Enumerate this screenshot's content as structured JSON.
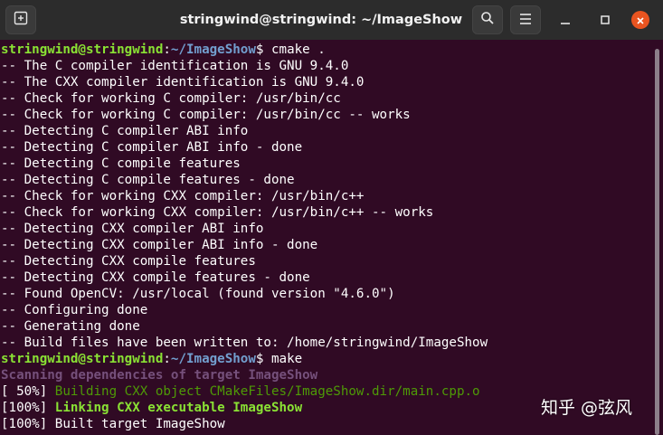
{
  "window": {
    "title": "stringwind@stringwind: ~/ImageShow"
  },
  "colors": {
    "background": "#300a24",
    "titlebar": "#2c2c2c",
    "prompt_user": "#8ae234",
    "prompt_path": "#729fcf",
    "scanning": "#75507b",
    "building": "#4e9a06",
    "close_button": "#e95420"
  },
  "icons": {
    "new_tab": "new-tab-icon",
    "search": "search-icon",
    "menu": "hamburger-menu-icon",
    "minimize": "minimize-icon",
    "maximize": "maximize-icon",
    "close": "close-icon"
  },
  "terminal": {
    "prompt1": {
      "user": "stringwind@stringwind",
      "sep": ":",
      "path": "~/ImageShow",
      "sym": "$ ",
      "cmd": "cmake ."
    },
    "cmake_output": [
      "-- The C compiler identification is GNU 9.4.0",
      "-- The CXX compiler identification is GNU 9.4.0",
      "-- Check for working C compiler: /usr/bin/cc",
      "-- Check for working C compiler: /usr/bin/cc -- works",
      "-- Detecting C compiler ABI info",
      "-- Detecting C compiler ABI info - done",
      "-- Detecting C compile features",
      "-- Detecting C compile features - done",
      "-- Check for working CXX compiler: /usr/bin/c++",
      "-- Check for working CXX compiler: /usr/bin/c++ -- works",
      "-- Detecting CXX compiler ABI info",
      "-- Detecting CXX compiler ABI info - done",
      "-- Detecting CXX compile features",
      "-- Detecting CXX compile features - done",
      "-- Found OpenCV: /usr/local (found version \"4.6.0\")",
      "-- Configuring done",
      "-- Generating done",
      "-- Build files have been written to: /home/stringwind/ImageShow"
    ],
    "prompt2": {
      "user": "stringwind@stringwind",
      "sep": ":",
      "path": "~/ImageShow",
      "sym": "$ ",
      "cmd": "make"
    },
    "make_output": {
      "scanning": "Scanning dependencies of target ImageShow",
      "build_pct": "[ 50%] ",
      "build_msg": "Building CXX object CMakeFiles/ImageShow.dir/main.cpp.o",
      "link_pct": "[100%] ",
      "link_msg": "Linking CXX executable ImageShow",
      "built": "[100%] Built target ImageShow"
    }
  },
  "watermark": "知乎 @弦风"
}
